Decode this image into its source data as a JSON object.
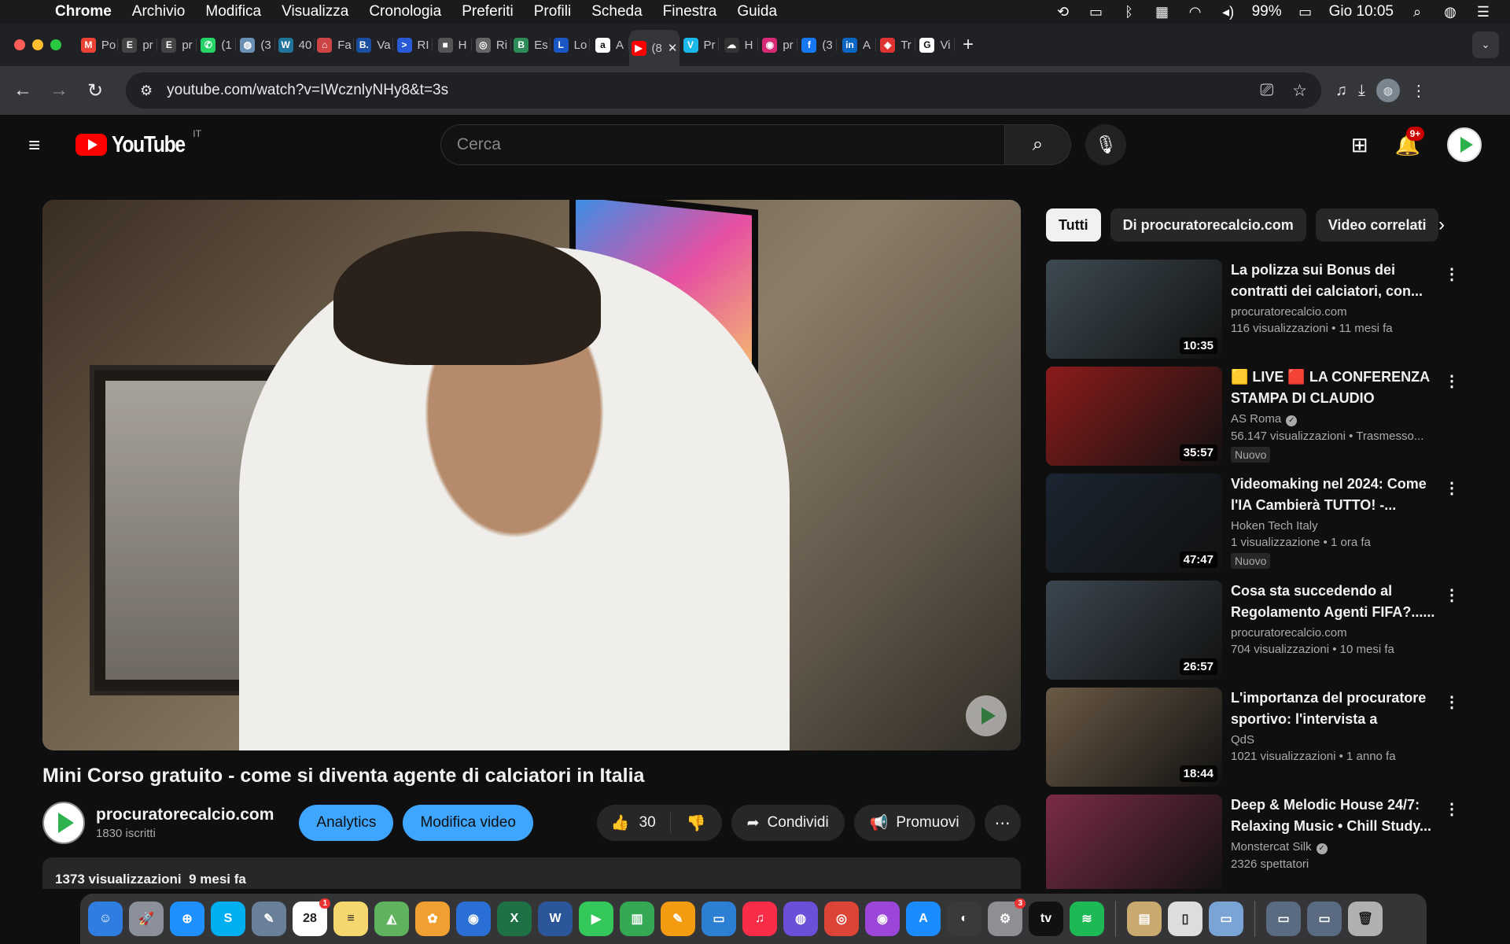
{
  "menubar": {
    "app_name": "Chrome",
    "items": [
      "Archivio",
      "Modifica",
      "Visualizza",
      "Cronologia",
      "Preferiti",
      "Profili",
      "Scheda",
      "Finestra",
      "Guida"
    ],
    "battery": "99%",
    "clock": "Gio 10:05"
  },
  "tabs": [
    {
      "title": "Po",
      "icon": "gmail-icon",
      "color": "#ea4335",
      "glyph": "M"
    },
    {
      "title": "pr",
      "icon": "e-icon",
      "color": "#444",
      "glyph": "E"
    },
    {
      "title": "pr",
      "icon": "e-icon",
      "color": "#444",
      "glyph": "E"
    },
    {
      "title": "(1",
      "icon": "whatsapp-icon",
      "color": "#25d366",
      "glyph": "✆"
    },
    {
      "title": "(3",
      "icon": "globe-icon",
      "color": "#6a8fb5",
      "glyph": "◍"
    },
    {
      "title": "40",
      "icon": "wordpress-icon",
      "color": "#21759b",
      "glyph": "W"
    },
    {
      "title": "Fa",
      "icon": "house-icon",
      "color": "#c44",
      "glyph": "⌂"
    },
    {
      "title": "Va",
      "icon": "b-icon",
      "color": "#1a4fa0",
      "glyph": "B."
    },
    {
      "title": "RI",
      "icon": "arrow-icon",
      "color": "#2a5bd7",
      "glyph": ">"
    },
    {
      "title": "H",
      "icon": "news-icon",
      "color": "#555",
      "glyph": "■"
    },
    {
      "title": "Ri",
      "icon": "circle-icon",
      "color": "#666",
      "glyph": "◎"
    },
    {
      "title": "Es",
      "icon": "b-circle-icon",
      "color": "#2e8b57",
      "glyph": "B"
    },
    {
      "title": "Lo",
      "icon": "l-icon",
      "color": "#1a56c4",
      "glyph": "L"
    },
    {
      "title": "A",
      "icon": "amazon-icon",
      "color": "#fff",
      "glyph": "a"
    },
    {
      "title": "(8",
      "icon": "youtube-icon",
      "color": "#ff0000",
      "glyph": "▶",
      "active": true
    },
    {
      "title": "Pr",
      "icon": "v-icon",
      "color": "#1ab7ea",
      "glyph": "V"
    },
    {
      "title": "H",
      "icon": "cloud-icon",
      "color": "#333",
      "glyph": "☁"
    },
    {
      "title": "pr",
      "icon": "instagram-icon",
      "color": "#d62976",
      "glyph": "◉"
    },
    {
      "title": "(3",
      "icon": "facebook-icon",
      "color": "#1877f2",
      "glyph": "f"
    },
    {
      "title": "A",
      "icon": "linkedin-icon",
      "color": "#0a66c2",
      "glyph": "in"
    },
    {
      "title": "Tr",
      "icon": "shield-icon",
      "color": "#d33",
      "glyph": "◈"
    },
    {
      "title": "Vi",
      "icon": "google-icon",
      "color": "#fff",
      "glyph": "G"
    }
  ],
  "address_bar": {
    "url": "youtube.com/watch?v=IWcznlyNHy8&t=3s"
  },
  "youtube": {
    "logo_text": "YouTube",
    "country_code": "IT",
    "search_placeholder": "Cerca",
    "notifications_badge": "9+"
  },
  "video": {
    "title": "Mini Corso gratuito - come si diventa agente di calciatori in Italia",
    "channel": "procuratorecalcio.com",
    "subscribers": "1830 iscritti",
    "analytics_label": "Analytics",
    "edit_label": "Modifica video",
    "likes": "30",
    "share_label": "Condividi",
    "promote_label": "Promuovi",
    "views": "1373 visualizzazioni",
    "age": "9 mesi fa"
  },
  "chips": [
    "Tutti",
    "Di procuratorecalcio.com",
    "Video correlati"
  ],
  "recommendations": [
    {
      "title": "La polizza sui Bonus dei contratti dei calciatori, con...",
      "channel": "procuratorecalcio.com",
      "verified": false,
      "meta": "116 visualizzazioni  • 11 mesi fa",
      "duration": "10:35",
      "new": "",
      "thumb": "#3d4a52"
    },
    {
      "title": "🟨 LIVE 🟥 LA CONFERENZA STAMPA DI CLAUDIO RANIERI...",
      "channel": "AS Roma",
      "verified": true,
      "meta": "56.147 visualizzazioni  • Trasmesso...",
      "duration": "35:57",
      "new": "Nuovo",
      "thumb": "#8c1b1b"
    },
    {
      "title": "Videomaking nel 2024: Come l'IA Cambierà TUTTO! -...",
      "channel": "Hoken Tech Italy",
      "verified": false,
      "meta": "1 visualizzazione  • 1 ora fa",
      "duration": "47:47",
      "new": "Nuovo",
      "thumb": "#1a2430"
    },
    {
      "title": "Cosa sta succedendo al Regolamento Agenti FIFA?......",
      "channel": "procuratorecalcio.com",
      "verified": false,
      "meta": "704 visualizzazioni  • 10 mesi fa",
      "duration": "26:57",
      "new": "",
      "thumb": "#3b4650"
    },
    {
      "title": "L'importanza del procuratore sportivo: l'intervista a Gianluc...",
      "channel": "QdS",
      "verified": false,
      "meta": "1021 visualizzazioni  • 1 anno fa",
      "duration": "18:44",
      "new": "",
      "thumb": "#6b5a46"
    },
    {
      "title": "Deep & Melodic House 24/7: Relaxing Music • Chill Study...",
      "channel": "Monstercat Silk",
      "verified": true,
      "meta": "2326 spettatori",
      "duration": "",
      "new": "",
      "thumb": "#7a2c44"
    }
  ],
  "dock": [
    {
      "name": "finder-icon",
      "color": "#2f7de1",
      "glyph": "☺"
    },
    {
      "name": "launchpad-icon",
      "color": "#8a8f99",
      "glyph": "🚀"
    },
    {
      "name": "safari-icon",
      "color": "#1e90ff",
      "glyph": "⊕"
    },
    {
      "name": "skype-icon",
      "color": "#00aff0",
      "glyph": "S"
    },
    {
      "name": "preview-icon",
      "color": "#6a7f99",
      "glyph": "✎"
    },
    {
      "name": "calendar-icon",
      "color": "#fff",
      "glyph": "28",
      "badge": "1"
    },
    {
      "name": "notes-icon",
      "color": "#f5d76e",
      "glyph": "≡"
    },
    {
      "name": "maps-icon",
      "color": "#5fb35f",
      "glyph": "◭"
    },
    {
      "name": "photos-icon",
      "color": "#f0a030",
      "glyph": "✿"
    },
    {
      "name": "support-icon",
      "color": "#2a6fd6",
      "glyph": "◉"
    },
    {
      "name": "excel-icon",
      "color": "#1e7145",
      "glyph": "X"
    },
    {
      "name": "word-icon",
      "color": "#2b579a",
      "glyph": "W"
    },
    {
      "name": "facetime-icon",
      "color": "#34c759",
      "glyph": "▶"
    },
    {
      "name": "numbers-icon",
      "color": "#34a853",
      "glyph": "▥"
    },
    {
      "name": "pages-icon",
      "color": "#f39c12",
      "glyph": "✎"
    },
    {
      "name": "keynote-icon",
      "color": "#2d7fd3",
      "glyph": "▭"
    },
    {
      "name": "music-icon",
      "color": "#fa2d48",
      "glyph": "♫"
    },
    {
      "name": "siri-icon",
      "color": "#6b4fd8",
      "glyph": "◍"
    },
    {
      "name": "chrome-icon",
      "color": "#db4437",
      "glyph": "◎"
    },
    {
      "name": "podcasts-icon",
      "color": "#9b45d9",
      "glyph": "◉"
    },
    {
      "name": "appstore-icon",
      "color": "#1a8cff",
      "glyph": "A"
    },
    {
      "name": "camera-icon",
      "color": "#3a3a3a",
      "glyph": "◐"
    },
    {
      "name": "settings-icon",
      "color": "#8e8e93",
      "glyph": "⚙",
      "badge": "3"
    },
    {
      "name": "appletv-icon",
      "color": "#111",
      "glyph": "tv"
    },
    {
      "name": "spotify-icon",
      "color": "#1db954",
      "glyph": "≋"
    },
    {
      "name": "archive-icon",
      "color": "#c9a96e",
      "glyph": "▤"
    },
    {
      "name": "document-icon",
      "color": "#ddd",
      "glyph": "▯"
    },
    {
      "name": "screenshot-icon",
      "color": "#7aa4d6",
      "glyph": "▭"
    },
    {
      "name": "window-icon",
      "color": "#5a6a80",
      "glyph": "▭"
    },
    {
      "name": "window-icon-2",
      "color": "#5a6a80",
      "glyph": "▭"
    },
    {
      "name": "trash-icon",
      "color": "#b0b0b0",
      "glyph": "🗑"
    }
  ]
}
